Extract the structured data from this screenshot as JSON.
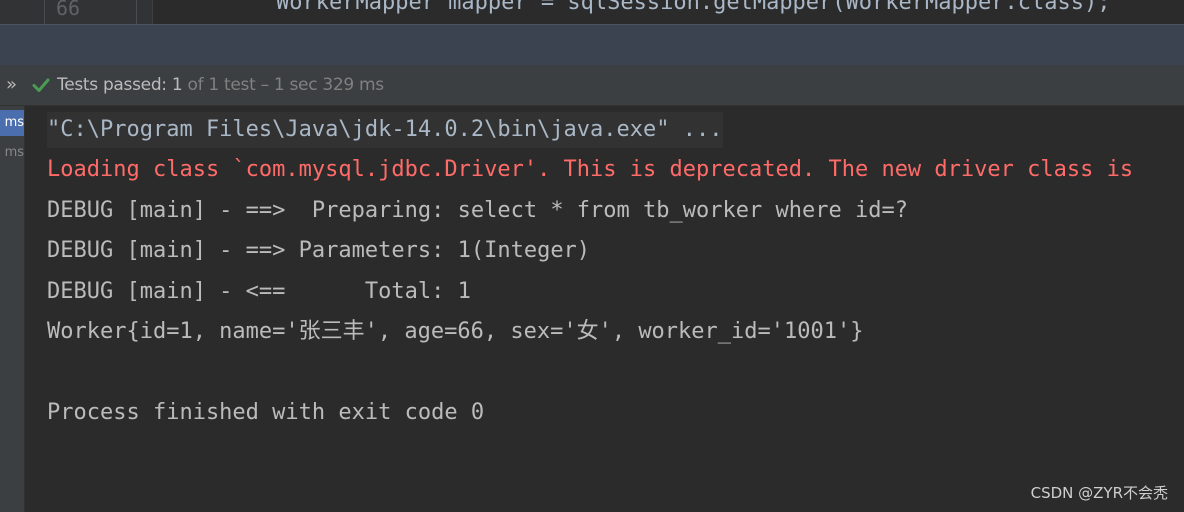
{
  "editor": {
    "line_number": "66",
    "code_fragment": "WorkerMapper mapper = sqlSession.getMapper(WorkerMapper.class);"
  },
  "status": {
    "expand_glyph": "»",
    "label": "Tests passed:",
    "passed_count": "1",
    "total": "of 1 test",
    "duration": "– 1 sec 329 ms"
  },
  "tree": {
    "rows": [
      {
        "text": "ms",
        "selected": true
      },
      {
        "text": "ms",
        "selected": false
      }
    ]
  },
  "console": {
    "lines": [
      {
        "text": "\"C:\\Program Files\\Java\\jdk-14.0.2\\bin\\java.exe\" ...",
        "kind": "cmd"
      },
      {
        "text": "Loading class `com.mysql.jdbc.Driver'. This is deprecated. The new driver class is",
        "kind": "err"
      },
      {
        "text": "DEBUG [main] - ==>  Preparing: select * from tb_worker where id=?",
        "kind": "out"
      },
      {
        "text": "DEBUG [main] - ==> Parameters: 1(Integer)",
        "kind": "out"
      },
      {
        "text": "DEBUG [main] - <==      Total: 1",
        "kind": "out"
      },
      {
        "text": "Worker{id=1, name='张三丰', age=66, sex='女', worker_id='1001'}",
        "kind": "out"
      },
      {
        "text": "",
        "kind": "out"
      },
      {
        "text": "Process finished with exit code 0",
        "kind": "out"
      }
    ]
  },
  "watermark": "CSDN @ZYR不会秃",
  "colors": {
    "success_green": "#499c54",
    "error_red": "#ff6b68",
    "selection_blue": "#4b6eaf"
  },
  "icons": {
    "check": "check-icon",
    "expand": "double-chevron-icon"
  }
}
